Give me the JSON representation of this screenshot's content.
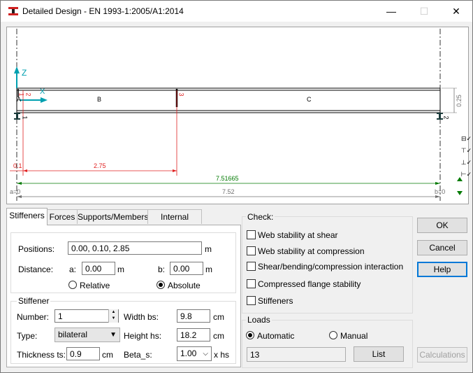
{
  "window": {
    "title": "Detailed Design - EN 1993-1:2005/A1:2014",
    "controls": {
      "minimize": "—",
      "maximize": "☐",
      "close": "✕"
    }
  },
  "drawing": {
    "axis_z": "Z",
    "axis_x": "X",
    "segment_labels": [
      "A",
      "B",
      "C"
    ],
    "stiffener_markers": [
      "1",
      "2",
      "3"
    ],
    "support_labels": [
      "1",
      "2"
    ],
    "height_dim": "0.25",
    "dim_01": "0.1",
    "dim_275": "2.75",
    "dim_751665": "7.51665",
    "dim_752": "7.52",
    "a_label": "a=0",
    "b_label": "b=0",
    "colors": {
      "red": "#e02020",
      "green": "#007a00",
      "cyan": "#00a0b0"
    }
  },
  "tabs": [
    "Stiffeners",
    "Forces",
    "Supports/Members",
    "Internal forces"
  ],
  "stiffeners": {
    "positions_label": "Positions:",
    "positions_value": "0.00, 0.10, 2.85",
    "positions_unit": "m",
    "distance_label": "Distance:",
    "a_label": "a:",
    "a_value": "0.00",
    "a_unit": "m",
    "b_label": "b:",
    "b_value": "0.00",
    "b_unit": "m",
    "relative_label": "Relative",
    "absolute_label": "Absolute",
    "stiffener_group": "Stiffener",
    "number_label": "Number:",
    "number_value": "1",
    "type_label": "Type:",
    "type_value": "bilateral",
    "thickness_label": "Thickness ts:",
    "thickness_value": "0.9",
    "thickness_unit": "cm",
    "width_label": "Width bs:",
    "width_value": "9.8",
    "width_unit": "cm",
    "height_label": "Height hs:",
    "height_value": "18.2",
    "height_unit": "cm",
    "beta_label": "Beta_s:",
    "beta_value": "1.00",
    "beta_unit": "x  hs"
  },
  "check": {
    "title": "Check:",
    "items": [
      "Web stability at shear",
      "Web stability at compression",
      "Shear/bending/compression interaction",
      "Compressed flange stability",
      "Stiffeners"
    ]
  },
  "loads": {
    "title": "Loads",
    "automatic_label": "Automatic",
    "manual_label": "Manual",
    "value": "13",
    "list_button": "List"
  },
  "buttons": {
    "ok": "OK",
    "cancel": "Cancel",
    "help": "Help",
    "calculations": "Calculations"
  }
}
